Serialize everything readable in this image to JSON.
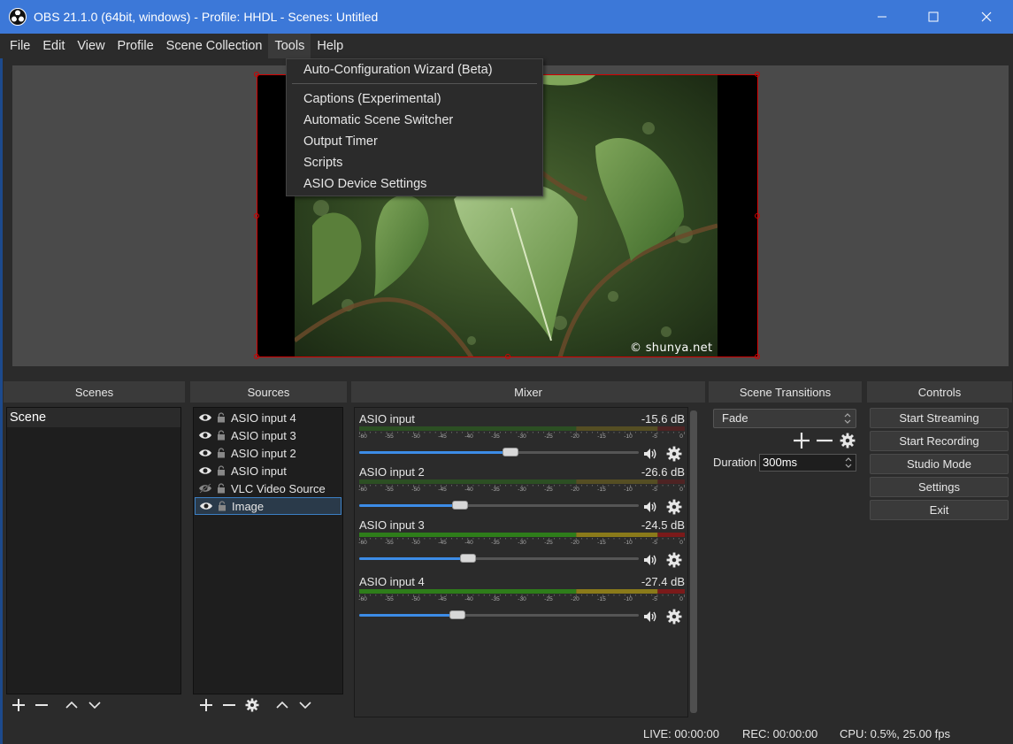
{
  "window": {
    "title": "OBS 21.1.0 (64bit, windows) - Profile: HHDL - Scenes: Untitled",
    "minimize_glyph": "—",
    "maximize_glyph": "☐",
    "close_glyph": "✕"
  },
  "menubar": [
    "File",
    "Edit",
    "View",
    "Profile",
    "Scene Collection",
    "Tools",
    "Help"
  ],
  "tools_menu": {
    "items": [
      "Auto-Configuration Wizard (Beta)",
      "Captions (Experimental)",
      "Automatic Scene Switcher",
      "Output Timer",
      "Scripts",
      "ASIO Device Settings"
    ]
  },
  "preview": {
    "watermark": "© shunya.net"
  },
  "docks": {
    "scenes": "Scenes",
    "sources": "Sources",
    "mixer": "Mixer",
    "transitions": "Scene Transitions",
    "controls": "Controls"
  },
  "scenes": [
    "Scene"
  ],
  "sources": [
    {
      "name": "ASIO input 4",
      "visible": true
    },
    {
      "name": "ASIO input 3",
      "visible": true
    },
    {
      "name": "ASIO input 2",
      "visible": true
    },
    {
      "name": "ASIO input",
      "visible": true
    },
    {
      "name": "VLC Video Source",
      "visible": false
    },
    {
      "name": "Image",
      "visible": true,
      "selected": true
    }
  ],
  "mixer": {
    "tick_labels": [
      "-60",
      "-55",
      "-50",
      "-45",
      "-40",
      "-35",
      "-30",
      "-25",
      "-20",
      "-15",
      "-10",
      "-5",
      "0"
    ],
    "channels": [
      {
        "name": "ASIO input",
        "db": "-15.6 dB",
        "fader": 0.54,
        "active": false
      },
      {
        "name": "ASIO input 2",
        "db": "-26.6 dB",
        "fader": 0.36,
        "active": false
      },
      {
        "name": "ASIO input 3",
        "db": "-24.5 dB",
        "fader": 0.39,
        "active": true
      },
      {
        "name": "ASIO input 4",
        "db": "-27.4 dB",
        "fader": 0.35,
        "active": true
      }
    ]
  },
  "transitions": {
    "selected": "Fade",
    "duration_label": "Duration",
    "duration_value": "300ms"
  },
  "controls": [
    "Start Streaming",
    "Start Recording",
    "Studio Mode",
    "Settings",
    "Exit"
  ],
  "status": {
    "live": "LIVE: 00:00:00",
    "rec": "REC: 00:00:00",
    "cpu": "CPU: 0.5%, 25.00 fps"
  },
  "colors": {
    "titlebar": "#3c78d8",
    "selection": "#d40000",
    "fader": "#3c8ce7",
    "meter_green": "#2e7d1a",
    "meter_yellow": "#8a7a1a",
    "meter_red": "#7a1a1a"
  }
}
